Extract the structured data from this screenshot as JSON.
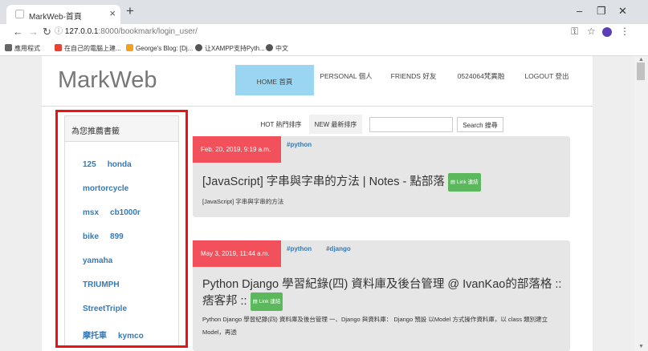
{
  "browser": {
    "tab_title": "MarkWeb-首頁",
    "url_host": "127.0.0.1",
    "url_path": ":8000/bookmark/login_user/",
    "bookmarks": [
      "應用程式",
      "在自己的電腦上建...",
      "George's Blog: [Dj...",
      "让XAMPP支持Pyth...",
      "中文"
    ],
    "bookmark_colors": [
      "#e94235",
      "#f4a11d",
      "#555555",
      "#555555"
    ]
  },
  "brand": "MarkWeb",
  "nav": [
    {
      "label": "HOME 首頁",
      "active": true
    },
    {
      "label": "PERSONAL 個人"
    },
    {
      "label": "FRIENDS 好友"
    },
    {
      "label": "0524064梵異融"
    },
    {
      "label": "LOGOUT 登出"
    }
  ],
  "sidebar": {
    "title": "為您推薦書籤",
    "rows": [
      [
        "125",
        "honda"
      ],
      [
        "mortorcycle"
      ],
      [
        "msx",
        "cb1000r"
      ],
      [
        "bike",
        "899"
      ],
      [
        "yamaha"
      ],
      [
        "TRIUMPH"
      ],
      [
        "StreetTriple"
      ],
      [
        "摩托車",
        "kymco"
      ]
    ]
  },
  "sort": {
    "hot": "HOT 熱門排序",
    "new": "NEW 最新排序"
  },
  "search": {
    "placeholder": "",
    "button": "Search 搜尋"
  },
  "cards": [
    {
      "date": "Feb. 20, 2019, 9:19 a.m.",
      "tags": [
        "#python"
      ],
      "title": "[JavaScript] 字串與字串的方法 | Notes - 點部落",
      "badge": "Link 連結",
      "desc": "[JavaScript] 字串與字串的方法"
    },
    {
      "date": "May 3, 2019, 11:44 a.m.",
      "tags": [
        "#python",
        "#django"
      ],
      "title": "Python Django 學習紀錄(四) 資料庫及後台管理 @ IvanKao的部落格 :: 痞客邦 ::",
      "badge": "Link 連結",
      "desc": "Python Django 學習紀錄(四) 資料庫及後台管理 一、Django 與資料庫： Django 預設 以Model 方式操作資料庫，以 class 類別建立 Model，再透"
    }
  ]
}
